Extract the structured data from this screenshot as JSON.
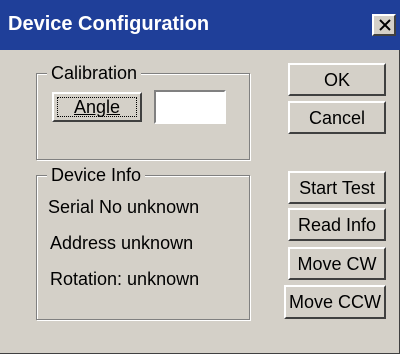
{
  "window": {
    "title": "Device Configuration"
  },
  "calibration": {
    "group_label": "Calibration",
    "angle_button": "Angle",
    "angle_value": ""
  },
  "device_info": {
    "group_label": "Device Info",
    "serial": "Serial No unknown",
    "address": "Address unknown",
    "rotation": "Rotation: unknown"
  },
  "buttons": {
    "ok": "OK",
    "cancel": "Cancel",
    "start_test": "Start Test",
    "read_info": "Read Info",
    "move_cw": "Move CW",
    "move_ccw": "Move CCW"
  },
  "colors": {
    "title_bar": "#1f3f99",
    "face": "#d4d0c8"
  }
}
